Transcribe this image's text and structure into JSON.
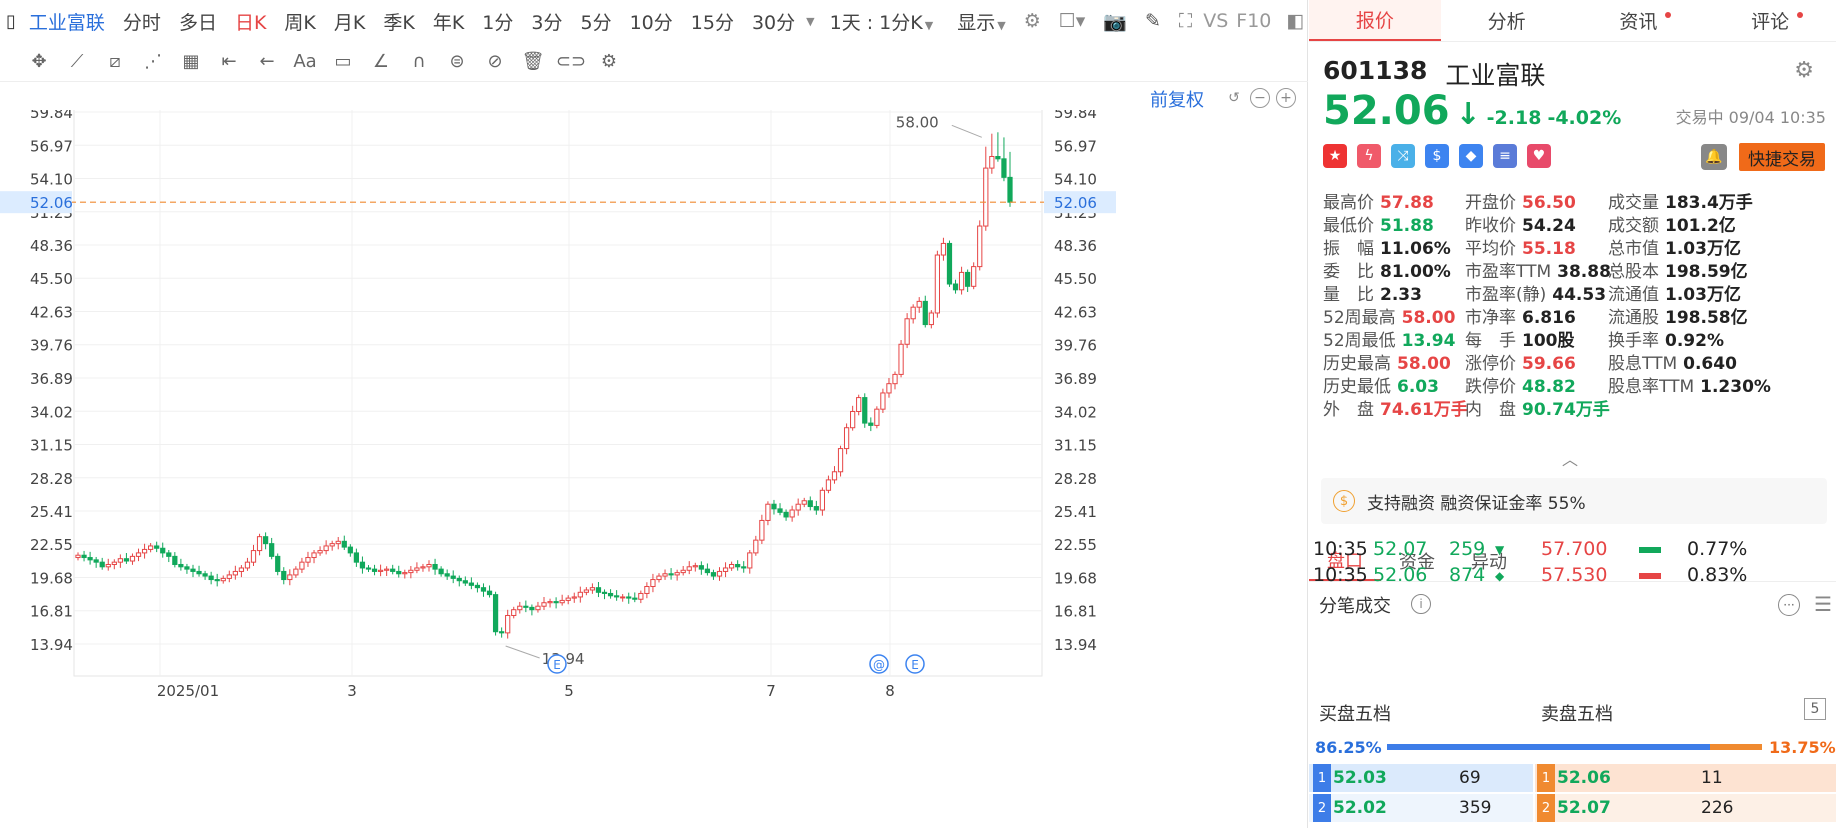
{
  "toolbar": {
    "stock_name": "工业富联",
    "periods": [
      "分时",
      "多日",
      "日K",
      "周K",
      "月K",
      "季K",
      "年K",
      "1分",
      "3分",
      "5分",
      "10分",
      "15分",
      "30分"
    ],
    "active_period": "日K",
    "interval_select": "1天 : 1分K",
    "display_label": "显示",
    "vs_label": "VS",
    "f10_label": "F10"
  },
  "chart": {
    "adjust_label": "前复权",
    "y_ticks": [
      "59.84",
      "56.97",
      "54.10",
      "51.23",
      "48.36",
      "45.50",
      "42.63",
      "39.76",
      "36.89",
      "34.02",
      "31.15",
      "28.28",
      "25.41",
      "22.55",
      "19.68",
      "16.81",
      "13.94"
    ],
    "x_ticks": [
      "2025/01",
      "3",
      "5",
      "7",
      "8"
    ],
    "current_price_label": "52.06",
    "high_annotation": "58.00",
    "low_annotation": "13.94",
    "event_markers": [
      "E",
      "@",
      "E"
    ]
  },
  "chart_data": {
    "type": "candlestick",
    "title": "",
    "ylim": [
      13.94,
      59.84
    ],
    "y_ticks": [
      59.84,
      56.97,
      54.1,
      51.23,
      48.36,
      45.5,
      42.63,
      39.76,
      36.89,
      34.02,
      31.15,
      28.28,
      25.41,
      22.55,
      19.68,
      16.81,
      13.94
    ],
    "x_ticks": [
      "2025/01",
      "3",
      "5",
      "7",
      "8"
    ],
    "current_price": 52.06,
    "period_high": 58.0,
    "period_low": 13.94,
    "close_series": [
      21.6,
      21.4,
      21.2,
      21.0,
      20.6,
      20.8,
      21.0,
      21.3,
      21.1,
      21.5,
      21.8,
      22.1,
      22.4,
      22.2,
      21.8,
      21.5,
      20.8,
      20.6,
      20.4,
      20.2,
      20.0,
      19.8,
      19.5,
      19.4,
      19.6,
      19.9,
      20.2,
      20.5,
      21.0,
      22.0,
      23.2,
      22.6,
      21.5,
      20.2,
      19.5,
      19.9,
      20.4,
      21.0,
      21.4,
      21.8,
      22.0,
      22.4,
      22.6,
      22.8,
      22.3,
      21.8,
      21.0,
      20.5,
      20.4,
      20.2,
      20.3,
      20.4,
      20.2,
      20.0,
      20.1,
      20.3,
      20.5,
      20.6,
      20.8,
      20.4,
      20.0,
      19.8,
      19.6,
      19.4,
      19.2,
      19.0,
      18.8,
      18.5,
      18.2,
      15.0,
      14.9,
      16.4,
      16.9,
      17.2,
      17.1,
      16.9,
      17.2,
      17.5,
      17.6,
      17.5,
      17.7,
      17.9,
      18.0,
      18.4,
      18.6,
      18.8,
      18.4,
      18.3,
      18.1,
      18.0,
      18.0,
      17.9,
      17.8,
      18.3,
      18.9,
      19.5,
      19.8,
      20.0,
      19.9,
      20.1,
      20.3,
      20.6,
      20.7,
      20.4,
      20.1,
      19.8,
      20.2,
      20.5,
      20.8,
      20.6,
      20.5,
      21.8,
      22.9,
      24.6,
      26.0,
      25.6,
      25.3,
      24.9,
      25.5,
      26.0,
      26.3,
      25.8,
      25.5,
      27.2,
      28.1,
      28.8,
      30.8,
      32.6,
      34.0,
      35.2,
      33.0,
      32.8,
      34.2,
      35.6,
      36.4,
      37.2,
      39.8,
      42.0,
      43.0,
      43.5,
      41.5,
      42.5,
      47.5,
      48.5,
      45.0,
      44.5,
      46.0,
      44.8,
      46.5,
      50.0,
      55.0,
      56.0,
      55.8,
      54.2,
      52.06
    ]
  },
  "right": {
    "tabs": [
      "报价",
      "分析",
      "资讯",
      "评论"
    ],
    "active_tab": "报价",
    "code": "601138",
    "name": "工业富联",
    "price": "52.06",
    "change": "-2.18",
    "change_pct": "-4.02%",
    "trade_status": "交易中 09/04 10:35",
    "quick_trade": "快捷交易",
    "stats": [
      {
        "label": "最高价",
        "value": "57.88",
        "color": "red"
      },
      {
        "label": "开盘价",
        "value": "56.50",
        "color": "red"
      },
      {
        "label": "成交量",
        "value": "183.4万手",
        "color": "dark"
      },
      {
        "label": "最低价",
        "value": "51.88",
        "color": "green"
      },
      {
        "label": "昨收价",
        "value": "54.24",
        "color": "dark"
      },
      {
        "label": "成交额",
        "value": "101.2亿",
        "color": "dark"
      },
      {
        "label": "振　幅",
        "value": "11.06%",
        "color": "dark"
      },
      {
        "label": "平均价",
        "value": "55.18",
        "color": "red"
      },
      {
        "label": "总市值",
        "value": "1.03万亿",
        "color": "dark"
      },
      {
        "label": "委　比",
        "value": "81.00%",
        "color": "dark"
      },
      {
        "label": "市盈率TTM",
        "value": "38.88",
        "color": "dark"
      },
      {
        "label": "总股本",
        "value": "198.59亿",
        "color": "dark"
      },
      {
        "label": "量　比",
        "value": "2.33",
        "color": "dark"
      },
      {
        "label": "市盈率(静)",
        "value": "44.53",
        "color": "dark"
      },
      {
        "label": "流通值",
        "value": "1.03万亿",
        "color": "dark"
      },
      {
        "label": "52周最高",
        "value": "58.00",
        "color": "red"
      },
      {
        "label": "市净率",
        "value": "6.816",
        "color": "dark"
      },
      {
        "label": "流通股",
        "value": "198.58亿",
        "color": "dark"
      },
      {
        "label": "52周最低",
        "value": "13.94",
        "color": "green"
      },
      {
        "label": "每　手",
        "value": "100股",
        "color": "dark"
      },
      {
        "label": "换手率",
        "value": "0.92%",
        "color": "dark"
      },
      {
        "label": "历史最高",
        "value": "58.00",
        "color": "red"
      },
      {
        "label": "涨停价",
        "value": "59.66",
        "color": "red"
      },
      {
        "label": "股息TTM",
        "value": "0.640",
        "color": "dark"
      },
      {
        "label": "历史最低",
        "value": "6.03",
        "color": "green"
      },
      {
        "label": "跌停价",
        "value": "48.82",
        "color": "green"
      },
      {
        "label": "股息率TTM",
        "value": "1.230%",
        "color": "dark"
      },
      {
        "label": "外　盘",
        "value": "74.61万手",
        "color": "red"
      },
      {
        "label": "内　盘",
        "value": "90.74万手",
        "color": "green"
      }
    ],
    "margin_text": "支持融资 融资保证金率 55%",
    "panel_tabs": [
      "盘口",
      "资金",
      "异动"
    ],
    "active_panel_tab": "盘口",
    "ticks_title": "分笔成交",
    "ticks": [
      {
        "time": "10:35",
        "price": "52.07",
        "vol": "259",
        "side": "▼",
        "ref": "57.700",
        "pct": "0.77%"
      },
      {
        "time": "10:35",
        "price": "52.06",
        "vol": "874",
        "side": "◆",
        "ref": "57.530",
        "pct": "0.83%"
      }
    ],
    "buy_title": "买盘五档",
    "sell_title": "卖盘五档",
    "five_label": "5",
    "buy_ratio": "86.25%",
    "sell_ratio": "13.75%",
    "buy_ratio_value": 0.8625,
    "book": [
      {
        "level": "1",
        "bid": "52.03",
        "bid_vol": "69",
        "ask": "52.06",
        "ask_vol": "11"
      },
      {
        "level": "2",
        "bid": "52.02",
        "bid_vol": "359",
        "ask": "52.07",
        "ask_vol": "226"
      }
    ],
    "colors": {
      "up": "#e64545",
      "down": "#11a85b",
      "accent": "#2a6fdb",
      "orange": "#f06a19"
    }
  }
}
